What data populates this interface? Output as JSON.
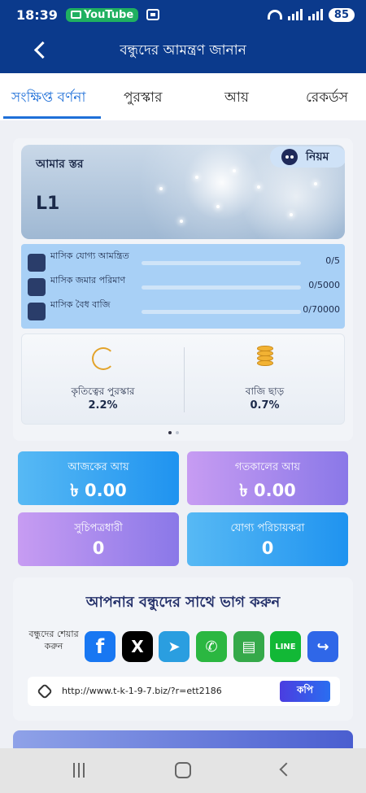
{
  "status_bar": {
    "time": "18:39",
    "app_badge": "YouTube",
    "battery": "85"
  },
  "header": {
    "title": "বন্ধুদের আমন্ত্রণ জানান"
  },
  "tabs": [
    {
      "label": "সংক্ষিপ্ত বর্ণনা",
      "active": true
    },
    {
      "label": "পুরস্কার",
      "active": false
    },
    {
      "label": "আয়",
      "active": false
    },
    {
      "label": "রেকর্ডস",
      "active": false
    }
  ],
  "level_card": {
    "label": "আমার স্তর",
    "level": "L1",
    "rule_label": "নিয়ম"
  },
  "progress": [
    {
      "label": "মাসিক যোগ্য আমন্ত্রিত",
      "value": "0/5",
      "fraction": 0
    },
    {
      "label": "মাসিক জমার পরিমাণ",
      "value": "0/5000",
      "fraction": 0
    },
    {
      "label": "মাসিক বৈধ বাজি",
      "value": "0/70000",
      "fraction": 0
    }
  ],
  "rewards": [
    {
      "title": "কৃতিত্বের পুরস্কার",
      "value": "2.2%"
    },
    {
      "title": "বাজি ছাড়",
      "value": "0.7%"
    }
  ],
  "stats": {
    "today": {
      "label": "আজকের আয়",
      "value": "৳ 0.00"
    },
    "yesterday": {
      "label": "গতকালের আয়",
      "value": "৳ 0.00"
    },
    "subscribers": {
      "label": "সুচিপত্রধারী",
      "value": "0"
    },
    "qualified": {
      "label": "যোগ্য পরিচায়করা",
      "value": "0"
    }
  },
  "share": {
    "title": "আপনার বন্ধুদের সাথে ভাগ করুন",
    "label": "বন্ধুদের শেয়ার করুন",
    "icons": [
      "facebook-icon",
      "x-icon",
      "telegram-icon",
      "whatsapp-icon",
      "sms-icon",
      "line-icon",
      "share-icon"
    ],
    "link": "http://www.t-k-1-9-7.biz/?r=ett2186",
    "copy_label": "কপি"
  },
  "colors": {
    "brand": "#0b3a8c",
    "accent": "#1e6fd8"
  }
}
